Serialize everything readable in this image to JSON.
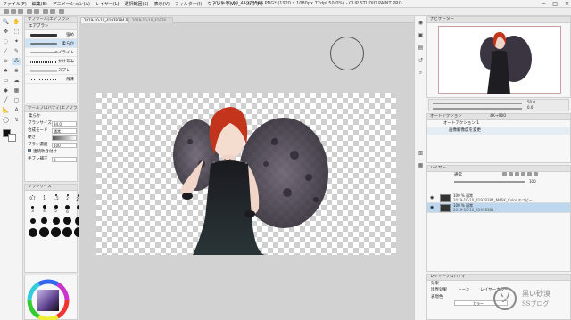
{
  "titlebar": {
    "menu": [
      "ファイル(F)",
      "編集(E)",
      "アニメーション(A)",
      "レイヤー(L)",
      "選択範囲(S)",
      "表示(V)",
      "フィルター(I)",
      "ウィンドウ(W)",
      "ヘルプ(H)"
    ],
    "title": "2019-10-10_41978384.PNG* (1920 x 1080px 72dpi 50.0%)  - CLIP STUDIO PAINT PRO"
  },
  "document_tabs": [
    "2019-10-10_41978384.PNG*",
    "2019-10-10_41978..."
  ],
  "brush_panel": {
    "header": "サブツール[エアブラシ]",
    "tab": "エアブラシ",
    "items": [
      {
        "label": "強め"
      },
      {
        "label": "柔らか"
      },
      {
        "label": "ハイライト"
      },
      {
        "label": "かけあみ"
      },
      {
        "label": "スプレー"
      },
      {
        "label": "飛沫"
      }
    ]
  },
  "tool_property": {
    "header": "ツールプロパティ[エアブラシ]",
    "rows": [
      {
        "label": "ブラシサイズ",
        "value": "34.0"
      },
      {
        "label": "合成モード",
        "value": "通常"
      },
      {
        "label": "硬さ",
        "value": ""
      },
      {
        "label": "ブラシ濃度",
        "value": "100"
      },
      {
        "label": "連続吹き付け",
        "value": ""
      },
      {
        "label": "手ブレ補正",
        "value": "3"
      }
    ]
  },
  "brush_size": {
    "header": "ブラシサイズ",
    "labels": [
      "0.7",
      "1",
      "1.5",
      "2",
      "2.5",
      "3",
      "4",
      "5",
      "6",
      "7"
    ]
  },
  "navigator": {
    "header": "ナビゲーター",
    "zoom": "50.0",
    "rotate": "0.0"
  },
  "auto_action": {
    "header": "オートアクション",
    "set": "オートアクション 1",
    "item": "画像解像度を変更",
    "ratio": "4K→900"
  },
  "layer_panel": {
    "header": "レイヤー",
    "blend": "通常",
    "opacity": "100",
    "layers": [
      {
        "name": "100 % 通常",
        "detail": "2019-10-10_41978384_MASK_Color のコピー"
      },
      {
        "name": "100 % 通常",
        "detail": "2019-10-10_41978384"
      }
    ]
  },
  "layer_property": {
    "header": "レイヤープロパティ",
    "effect_label": "効果",
    "effects": [
      "境界効果",
      "トーン",
      "レイヤーカラー"
    ],
    "expression_label": "表現色",
    "expression_value": "カラー"
  },
  "watermark": {
    "line1": "黒い砂漠",
    "line2": "SSブログ",
    "mark": "ソ"
  },
  "colors": {
    "accent": "#3b8fd9",
    "selection": "#bcd7ee",
    "canvas_bg": "#d2d2d2"
  }
}
